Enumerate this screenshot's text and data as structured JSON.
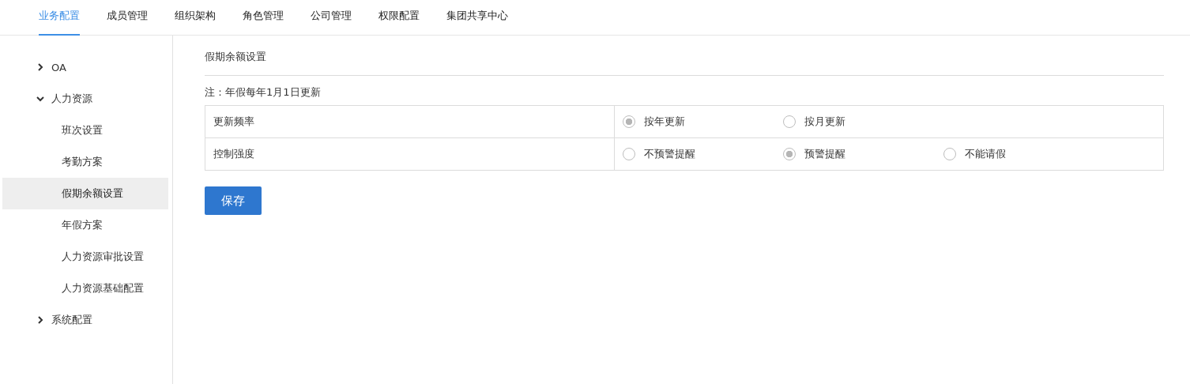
{
  "tabs": [
    {
      "label": "业务配置",
      "selected": true
    },
    {
      "label": "成员管理",
      "selected": false
    },
    {
      "label": "组织架构",
      "selected": false
    },
    {
      "label": "角色管理",
      "selected": false
    },
    {
      "label": "公司管理",
      "selected": false
    },
    {
      "label": "权限配置",
      "selected": false
    },
    {
      "label": "集团共享中心",
      "selected": false
    }
  ],
  "sidebar": {
    "items": [
      {
        "label": "OA",
        "expanded": false
      },
      {
        "label": "人力资源",
        "expanded": true,
        "children": [
          {
            "label": "班次设置",
            "selected": false
          },
          {
            "label": "考勤方案",
            "selected": false
          },
          {
            "label": "假期余额设置",
            "selected": true
          },
          {
            "label": "年假方案",
            "selected": false
          },
          {
            "label": "人力资源审批设置",
            "selected": false
          },
          {
            "label": "人力资源基础配置",
            "selected": false
          }
        ]
      },
      {
        "label": "系统配置",
        "expanded": false
      }
    ]
  },
  "page_title": "假期余额设置",
  "note": "注：年假每年1月1日更新",
  "settings": [
    {
      "label": "更新频率",
      "options": [
        {
          "label": "按年更新",
          "selected": true
        },
        {
          "label": "按月更新",
          "selected": false
        }
      ]
    },
    {
      "label": "控制强度",
      "options": [
        {
          "label": "不预警提醒",
          "selected": false
        },
        {
          "label": "预警提醒",
          "selected": true
        },
        {
          "label": "不能请假",
          "selected": false
        }
      ]
    }
  ],
  "save_button": "保存"
}
